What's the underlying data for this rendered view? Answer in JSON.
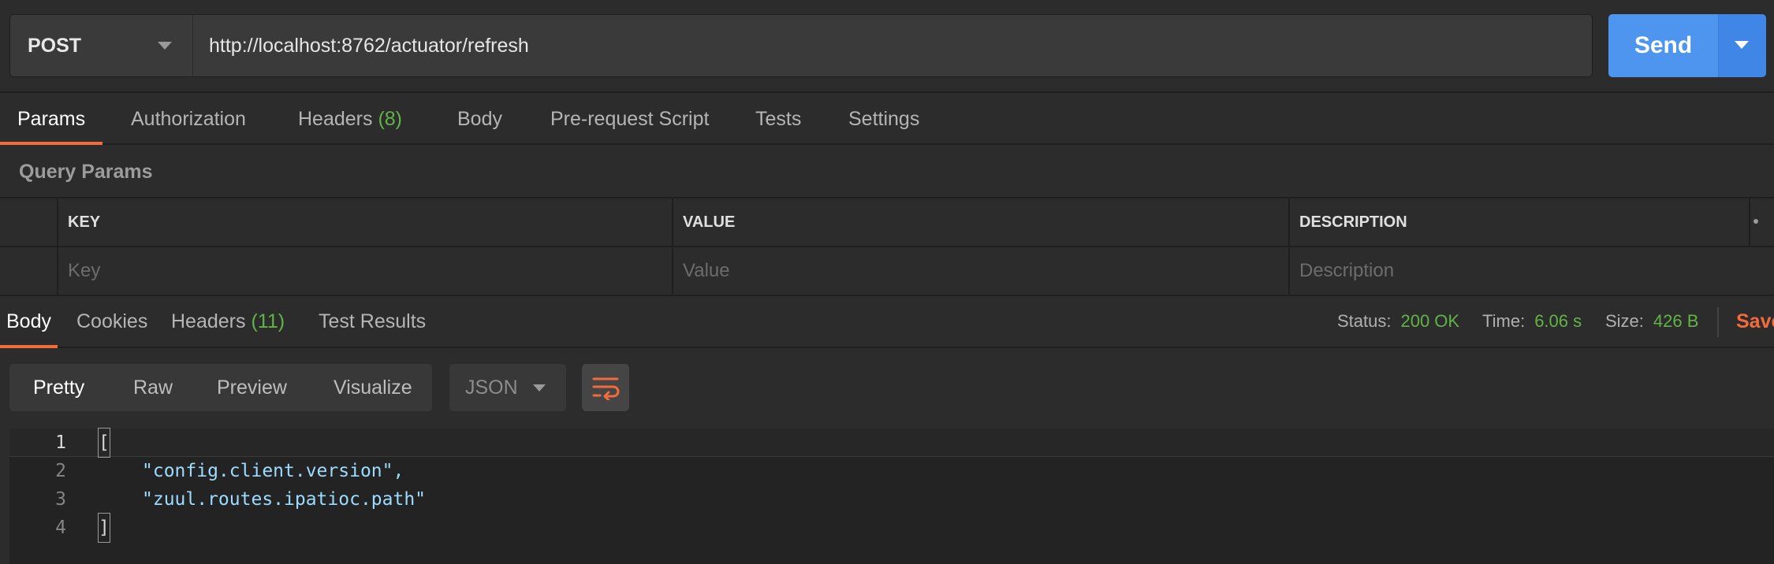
{
  "request": {
    "method": "POST",
    "url": "http://localhost:8762/actuator/refresh",
    "send_label": "Send"
  },
  "request_tabs": [
    {
      "label": "Params",
      "active": true
    },
    {
      "label": "Authorization"
    },
    {
      "label": "Headers",
      "count": "(8)"
    },
    {
      "label": "Body"
    },
    {
      "label": "Pre-request Script"
    },
    {
      "label": "Tests"
    },
    {
      "label": "Settings"
    }
  ],
  "query_params": {
    "title": "Query Params",
    "columns": [
      "KEY",
      "VALUE",
      "DESCRIPTION"
    ],
    "placeholders": [
      "Key",
      "Value",
      "Description"
    ]
  },
  "response_tabs": [
    {
      "label": "Body",
      "active": true
    },
    {
      "label": "Cookies"
    },
    {
      "label": "Headers",
      "count": "(11)"
    },
    {
      "label": "Test Results"
    }
  ],
  "response_status": {
    "status_label": "Status:",
    "status_value": "200 OK",
    "time_label": "Time:",
    "time_value": "6.06 s",
    "size_label": "Size:",
    "size_value": "426 B",
    "save_label": "Save"
  },
  "view_modes": [
    "Pretty",
    "Raw",
    "Preview",
    "Visualize"
  ],
  "format": "JSON",
  "code_lines": [
    {
      "no": "1",
      "text": "["
    },
    {
      "no": "2",
      "text": "\"config.client.version\","
    },
    {
      "no": "3",
      "text": "\"zuul.routes.ipatioc.path\""
    },
    {
      "no": "4",
      "text": "]"
    }
  ],
  "colors": {
    "accent": "#f26b3a",
    "send_blue": "#4d95ee",
    "success_green": "#62b347",
    "json_string": "#9cdcfe"
  },
  "icons": [
    "caret-down-icon",
    "wrap-lines-icon"
  ]
}
